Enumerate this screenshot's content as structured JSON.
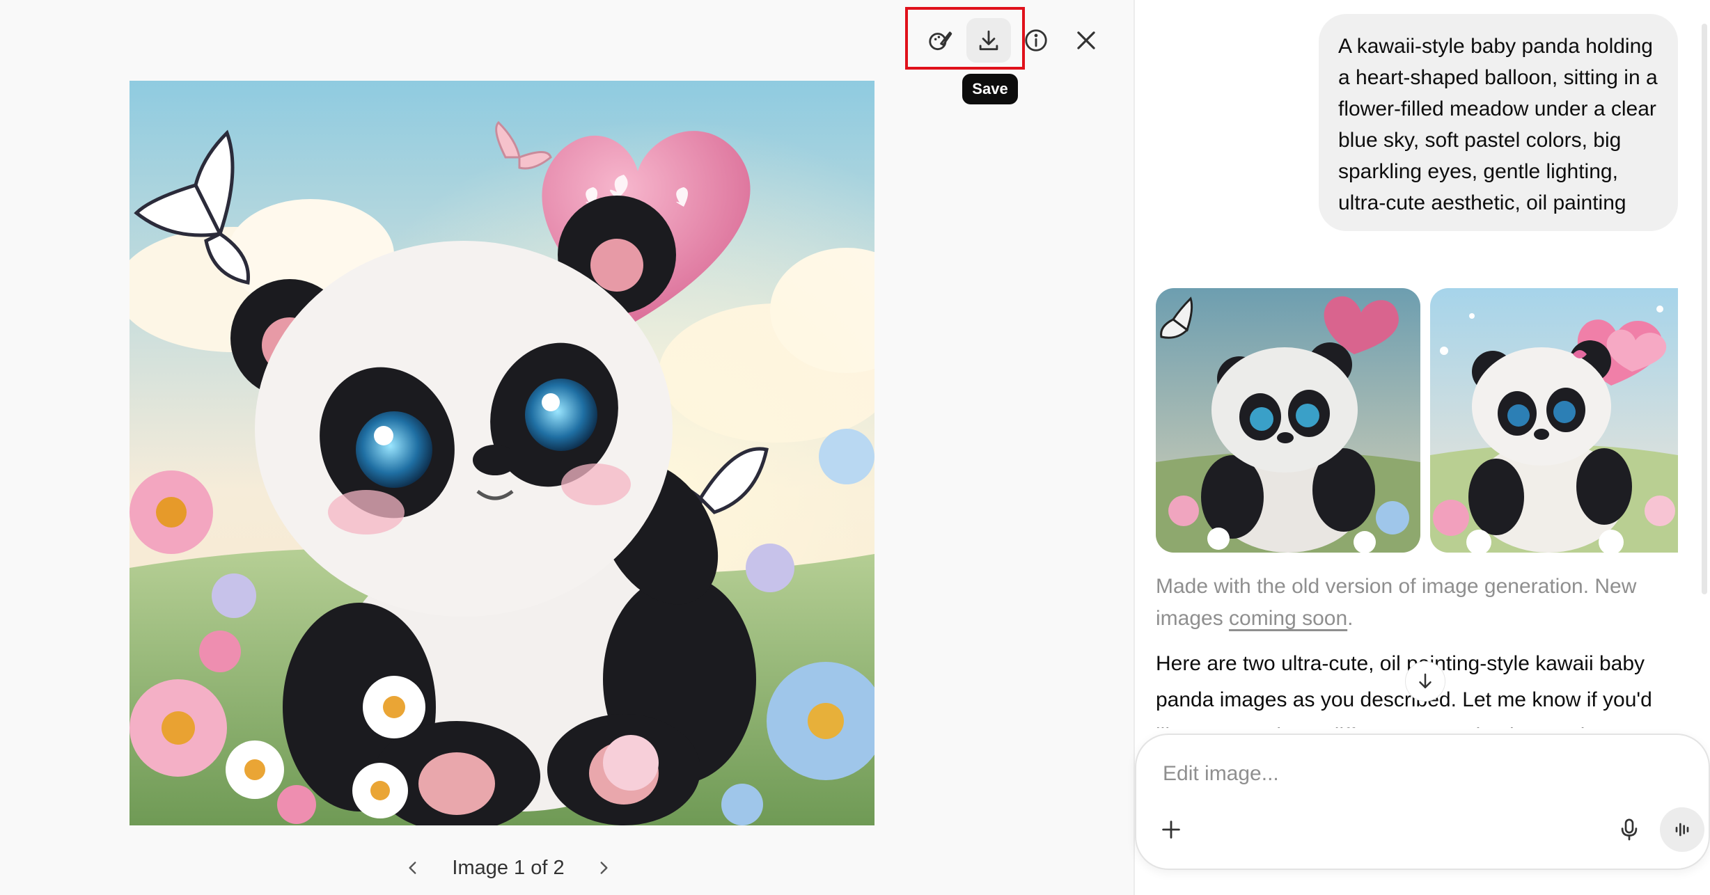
{
  "viewer": {
    "toolbar": {
      "edit_icon": "edit-image-icon",
      "save_icon": "download-icon",
      "info_icon": "info-icon",
      "close_icon": "close-icon",
      "save_tooltip": "Save",
      "highlight_color": "#e0111b"
    },
    "pager": {
      "label": "Image 1 of 2",
      "prev_icon": "chevron-left-icon",
      "next_icon": "chevron-right-icon"
    }
  },
  "chat": {
    "user_prompt": "A kawaii-style baby panda holding a heart-shaped balloon, sitting in a flower-filled meadow under a clear blue sky, soft pastel colors, big sparkling eyes, gentle lighting, ultra-cute aesthetic, oil painting",
    "note_text": "Made with the old version of image generation. New images ",
    "note_link": "coming soon",
    "note_end": ".",
    "reply_text": "Here are two ultra-cute, oil painting-style kawaii baby panda images as you described. Let me know if you'd like any tweaks or different poses, backgrounds, or colors!",
    "scroll_icon": "arrow-down-icon",
    "composer": {
      "placeholder": "Edit image...",
      "plus_icon": "plus-icon",
      "mic_icon": "microphone-icon",
      "voice_icon": "voice-mode-icon"
    }
  },
  "colors": {
    "balloon": "#ef8fb2",
    "sky": "#a9d8ea",
    "panda_black": "#1b1b1f"
  }
}
